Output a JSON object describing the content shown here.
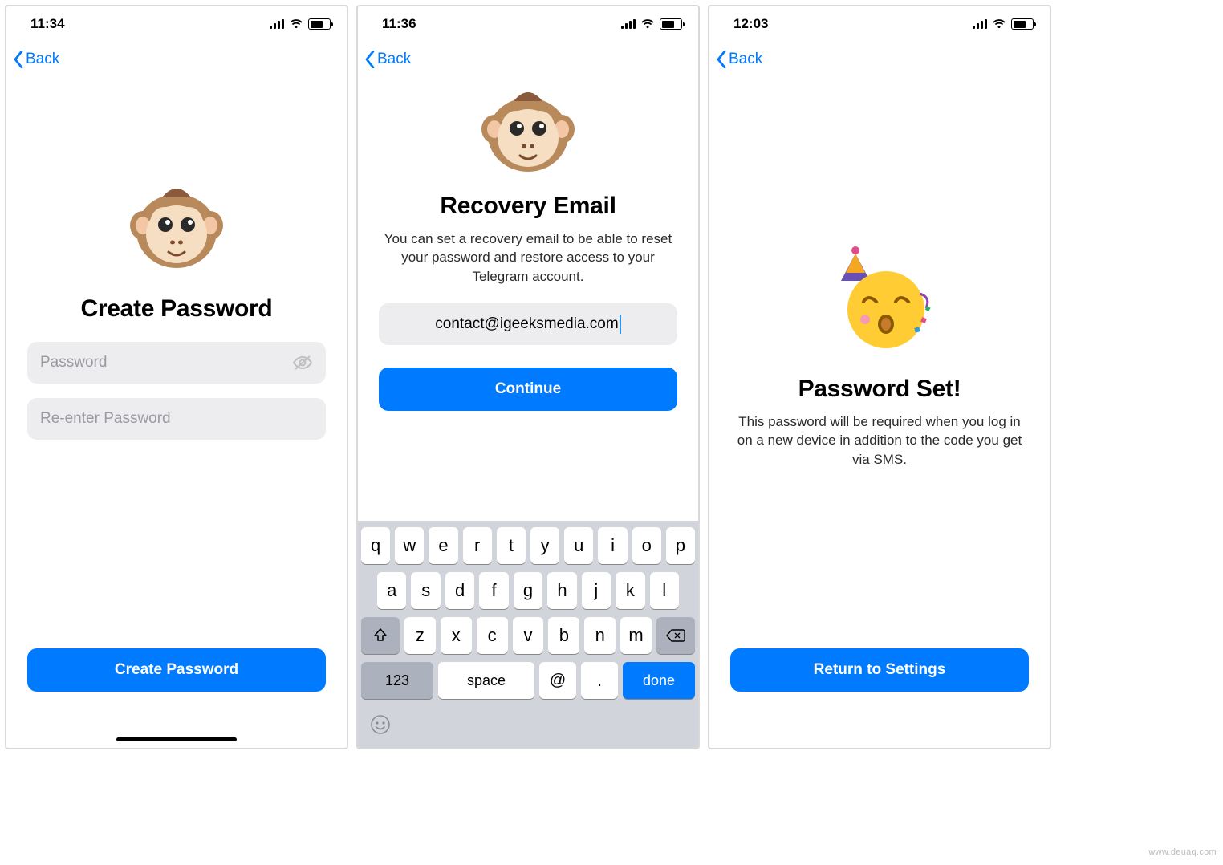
{
  "screens": [
    {
      "statusbar": {
        "time": "11:34"
      },
      "nav": {
        "back": "Back"
      },
      "title": "Create Password",
      "password_placeholder": "Password",
      "reenter_placeholder": "Re-enter Password",
      "primary": "Create Password",
      "icon": "monkey-face"
    },
    {
      "statusbar": {
        "time": "11:36"
      },
      "nav": {
        "back": "Back"
      },
      "title": "Recovery Email",
      "subtitle": "You can set a recovery email to be able to reset your password and restore access to your Telegram account.",
      "email_value": "contact@igeeksmedia.com",
      "primary": "Continue",
      "icon": "monkey-face",
      "keyboard": {
        "row1": [
          "q",
          "w",
          "e",
          "r",
          "t",
          "y",
          "u",
          "i",
          "o",
          "p"
        ],
        "row2": [
          "a",
          "s",
          "d",
          "f",
          "g",
          "h",
          "j",
          "k",
          "l"
        ],
        "row3": [
          "z",
          "x",
          "c",
          "v",
          "b",
          "n",
          "m"
        ],
        "num": "123",
        "space": "space",
        "at": "@",
        "dot": ".",
        "done": "done"
      }
    },
    {
      "statusbar": {
        "time": "12:03"
      },
      "nav": {
        "back": "Back"
      },
      "title": "Password Set!",
      "subtitle": "This password will be required when you log in on a new device in addition to the code you get via SMS.",
      "primary": "Return to Settings",
      "icon": "party-face"
    }
  ],
  "watermark": "www.deuaq.com"
}
